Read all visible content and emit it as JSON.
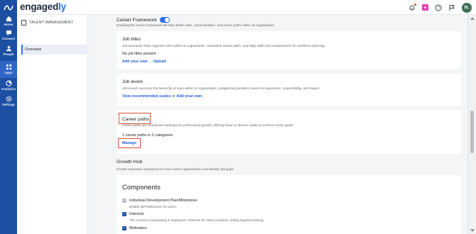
{
  "rail": {
    "items": [
      {
        "label": "Home",
        "icon": "home-icon"
      },
      {
        "label": "Connect",
        "icon": "connect-icon"
      },
      {
        "label": "People",
        "icon": "people-icon"
      },
      {
        "label": "Apps",
        "icon": "apps-icon"
      },
      {
        "label": "Analytics",
        "icon": "analytics-icon"
      },
      {
        "label": "Settings",
        "icon": "settings-icon"
      }
    ]
  },
  "topbar": {
    "brand_prefix": "engaged",
    "brand_suffix": "ly",
    "avatar_initials": "BL"
  },
  "leftnav": {
    "section": "TALENT MANAGEMENT",
    "item": "Overview"
  },
  "career_framework": {
    "title": "Career Framework",
    "enabled": true,
    "description": "Enabling the Career framework will help define roles, responsibilities, and career paths within an organization."
  },
  "job_titles": {
    "title": "Job titles",
    "description": "Job taxonomy helps organize roles within an organization, streamline career paths, and align skills and competencies for workforce planning.",
    "status": "No job titles present",
    "add_link": "Add your own",
    "separator": "|",
    "upload_link": "Upload"
  },
  "job_levels": {
    "title": "Job levels",
    "description": "Job Levels represent the hierarchy of roles within an organization, categorizing positions based on experience, responsibility, and impact.",
    "recommended_link": "View recommended scales",
    "or_text": "or",
    "add_link": "Add your own"
  },
  "career_paths": {
    "title": "Career paths",
    "description": "Career paths are structured roadmaps for professional growth, offering linear or diverse routes to achieve career goals.",
    "summary": "1 career paths in 2 categories",
    "manage_link": "Manage"
  },
  "growth_hub": {
    "title": "Growth Hub",
    "description": "Growth empowers employees to seize career opportunities and identify skill gaps."
  },
  "components": {
    "title": "Components",
    "options": [
      {
        "label": "Individual Development Plan/Milestones",
        "description": "Enable IDP/milestones for users.",
        "checked": true,
        "disabled": true
      },
      {
        "label": "Interests",
        "description": "This assists in pinpointing in employees' interests for future positions, aiding targeted training.",
        "checked": true,
        "disabled": false
      },
      {
        "label": "Motivators",
        "description": "",
        "checked": true,
        "disabled": false
      }
    ]
  },
  "colors": {
    "rail": "#1d4fa3",
    "accent": "#2f6fe0",
    "link": "#1f5ed6",
    "highlight": "#d8502c"
  }
}
